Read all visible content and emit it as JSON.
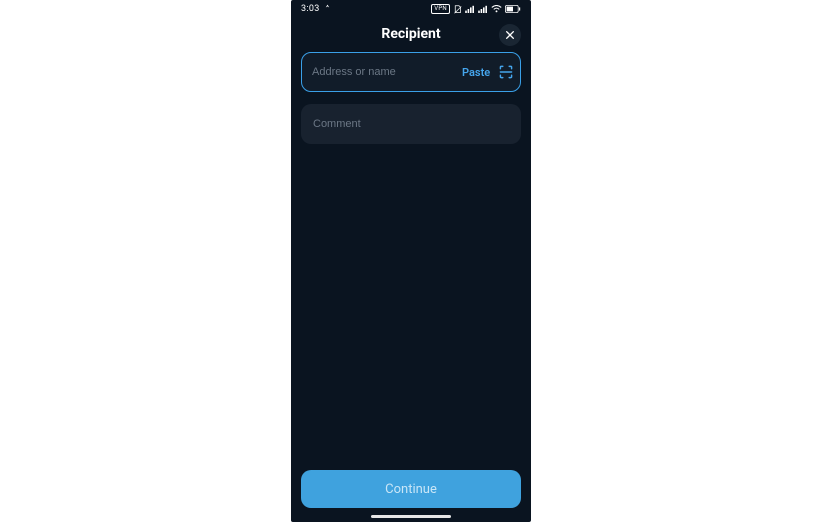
{
  "status_bar": {
    "time": "3:03",
    "vpn_label": "VPN"
  },
  "header": {
    "title": "Recipient"
  },
  "address": {
    "placeholder": "Address or name",
    "paste_label": "Paste"
  },
  "comment": {
    "placeholder": "Comment"
  },
  "continue_label": "Continue",
  "colors": {
    "bg": "#0a1420",
    "field_bg": "#18222f",
    "accent": "#45a5ec",
    "button": "#3fa2de"
  }
}
